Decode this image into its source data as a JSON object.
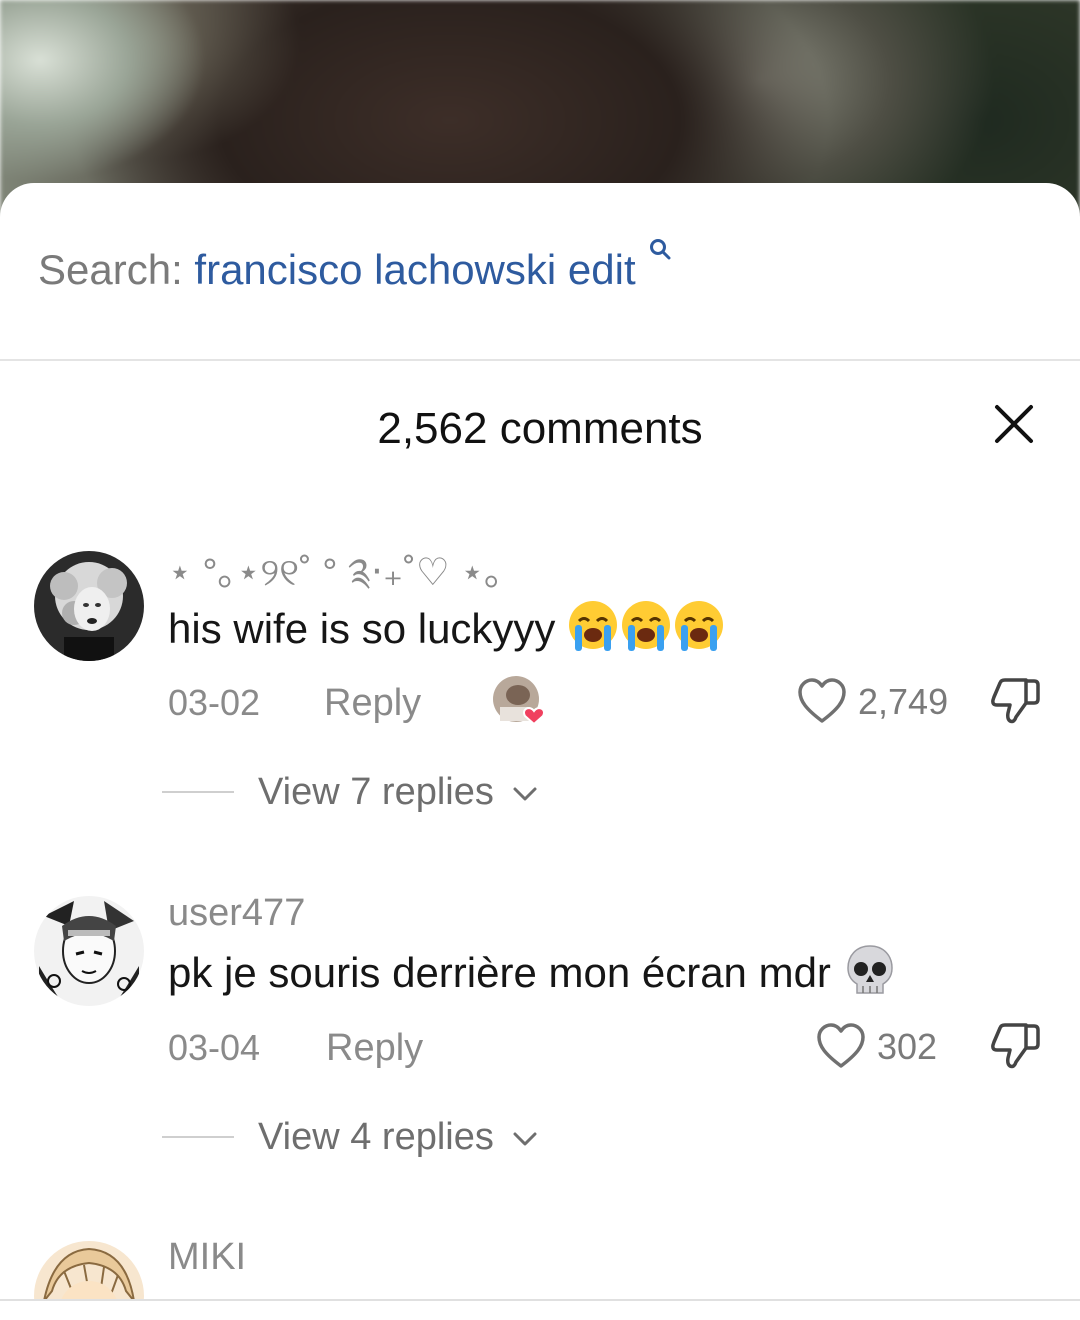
{
  "search": {
    "prefix": "Search:",
    "query": "francisco lachowski edit"
  },
  "header": {
    "title": "2,562 comments"
  },
  "comments": [
    {
      "username": "⋆ °｡⋆୨୧˚ ° ༉‧₊˚♡ ⋆｡",
      "text": "his wife is so luckyyy",
      "emoji": "loudly-crying-face x3",
      "date": "03-02",
      "reply_label": "Reply",
      "likes": "2,749",
      "creator_liked": true,
      "view_replies": "View 7 replies"
    },
    {
      "username": "user477",
      "text": "pk je souris derrière mon écran mdr",
      "emoji": "skull",
      "date": "03-04",
      "reply_label": "Reply",
      "likes": "302",
      "creator_liked": false,
      "view_replies": "View 4 replies"
    },
    {
      "username": "MIKI",
      "text": "",
      "date": "",
      "reply_label": "",
      "likes": ""
    }
  ],
  "colors": {
    "link_blue": "#2e5b9f",
    "muted_gray": "#8a8a8a",
    "heart_red": "#f0405f"
  }
}
